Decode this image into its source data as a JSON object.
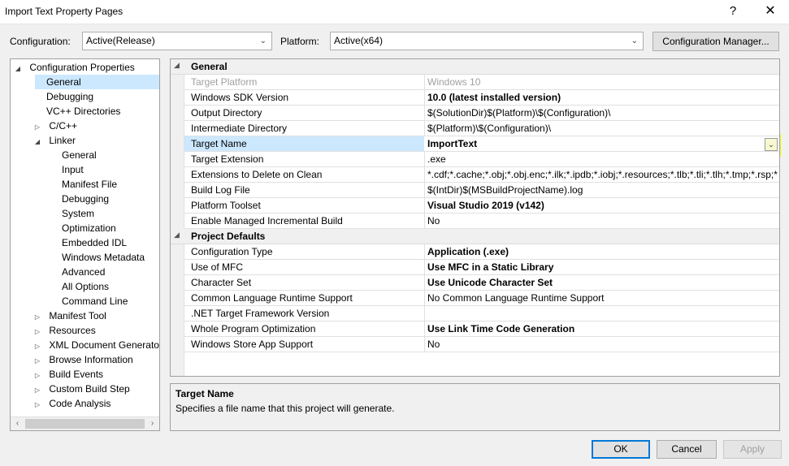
{
  "window": {
    "title": "Import Text Property Pages",
    "help_label": "?",
    "close_label": "✕"
  },
  "config": {
    "configuration_label": "Configuration:",
    "configuration_value": "Active(Release)",
    "platform_label": "Platform:",
    "platform_value": "Active(x64)",
    "manager_button": "Configuration Manager..."
  },
  "tree": {
    "items": [
      {
        "label": "Configuration Properties",
        "expander": "◢"
      },
      {
        "label": "General"
      },
      {
        "label": "Debugging"
      },
      {
        "label": "VC++ Directories"
      },
      {
        "label": "C/C++",
        "expander": "▷"
      },
      {
        "label": "Linker",
        "expander": "◢"
      },
      {
        "label": "General"
      },
      {
        "label": "Input"
      },
      {
        "label": "Manifest File"
      },
      {
        "label": "Debugging"
      },
      {
        "label": "System"
      },
      {
        "label": "Optimization"
      },
      {
        "label": "Embedded IDL"
      },
      {
        "label": "Windows Metadata"
      },
      {
        "label": "Advanced"
      },
      {
        "label": "All Options"
      },
      {
        "label": "Command Line"
      },
      {
        "label": "Manifest Tool",
        "expander": "▷"
      },
      {
        "label": "Resources",
        "expander": "▷"
      },
      {
        "label": "XML Document Generator",
        "expander": "▷"
      },
      {
        "label": "Browse Information",
        "expander": "▷"
      },
      {
        "label": "Build Events",
        "expander": "▷"
      },
      {
        "label": "Custom Build Step",
        "expander": "▷"
      },
      {
        "label": "Code Analysis",
        "expander": "▷"
      }
    ],
    "scroll_left": "‹",
    "scroll_right": "›"
  },
  "grid": {
    "general": {
      "label": "General",
      "expander": "◢",
      "rows": [
        {
          "name": "Target Platform",
          "value": "Windows 10"
        },
        {
          "name": "Windows SDK Version",
          "value": "10.0 (latest installed version)"
        },
        {
          "name": "Output Directory",
          "value": "$(SolutionDir)$(Platform)\\$(Configuration)\\"
        },
        {
          "name": "Intermediate Directory",
          "value": "$(Platform)\\$(Configuration)\\"
        },
        {
          "name": "Target Name",
          "value": "ImportText"
        },
        {
          "name": "Target Extension",
          "value": ".exe"
        },
        {
          "name": "Extensions to Delete on Clean",
          "value": "*.cdf;*.cache;*.obj;*.obj.enc;*.ilk;*.ipdb;*.iobj;*.resources;*.tlb;*.tli;*.tlh;*.tmp;*.rsp;*"
        },
        {
          "name": "Build Log File",
          "value": "$(IntDir)$(MSBuildProjectName).log"
        },
        {
          "name": "Platform Toolset",
          "value": "Visual Studio 2019 (v142)"
        },
        {
          "name": "Enable Managed Incremental Build",
          "value": "No"
        }
      ]
    },
    "project_defaults": {
      "label": "Project Defaults",
      "expander": "◢",
      "rows": [
        {
          "name": "Configuration Type",
          "value": "Application (.exe)"
        },
        {
          "name": "Use of MFC",
          "value": "Use MFC in a Static Library"
        },
        {
          "name": "Character Set",
          "value": "Use Unicode Character Set"
        },
        {
          "name": "Common Language Runtime Support",
          "value": "No Common Language Runtime Support"
        },
        {
          "name": ".NET Target Framework Version",
          "value": ""
        },
        {
          "name": "Whole Program Optimization",
          "value": "Use Link Time Code Generation"
        },
        {
          "name": "Windows Store App Support",
          "value": "No"
        }
      ]
    },
    "highlight_color": "#f6f600",
    "selected_color": "#cce8ff"
  },
  "description": {
    "title": "Target Name",
    "text": "Specifies a file name that this project will generate."
  },
  "buttons": {
    "ok": "OK",
    "cancel": "Cancel",
    "apply": "Apply"
  },
  "icons": {
    "dropdown": "chevron-down-icon"
  }
}
